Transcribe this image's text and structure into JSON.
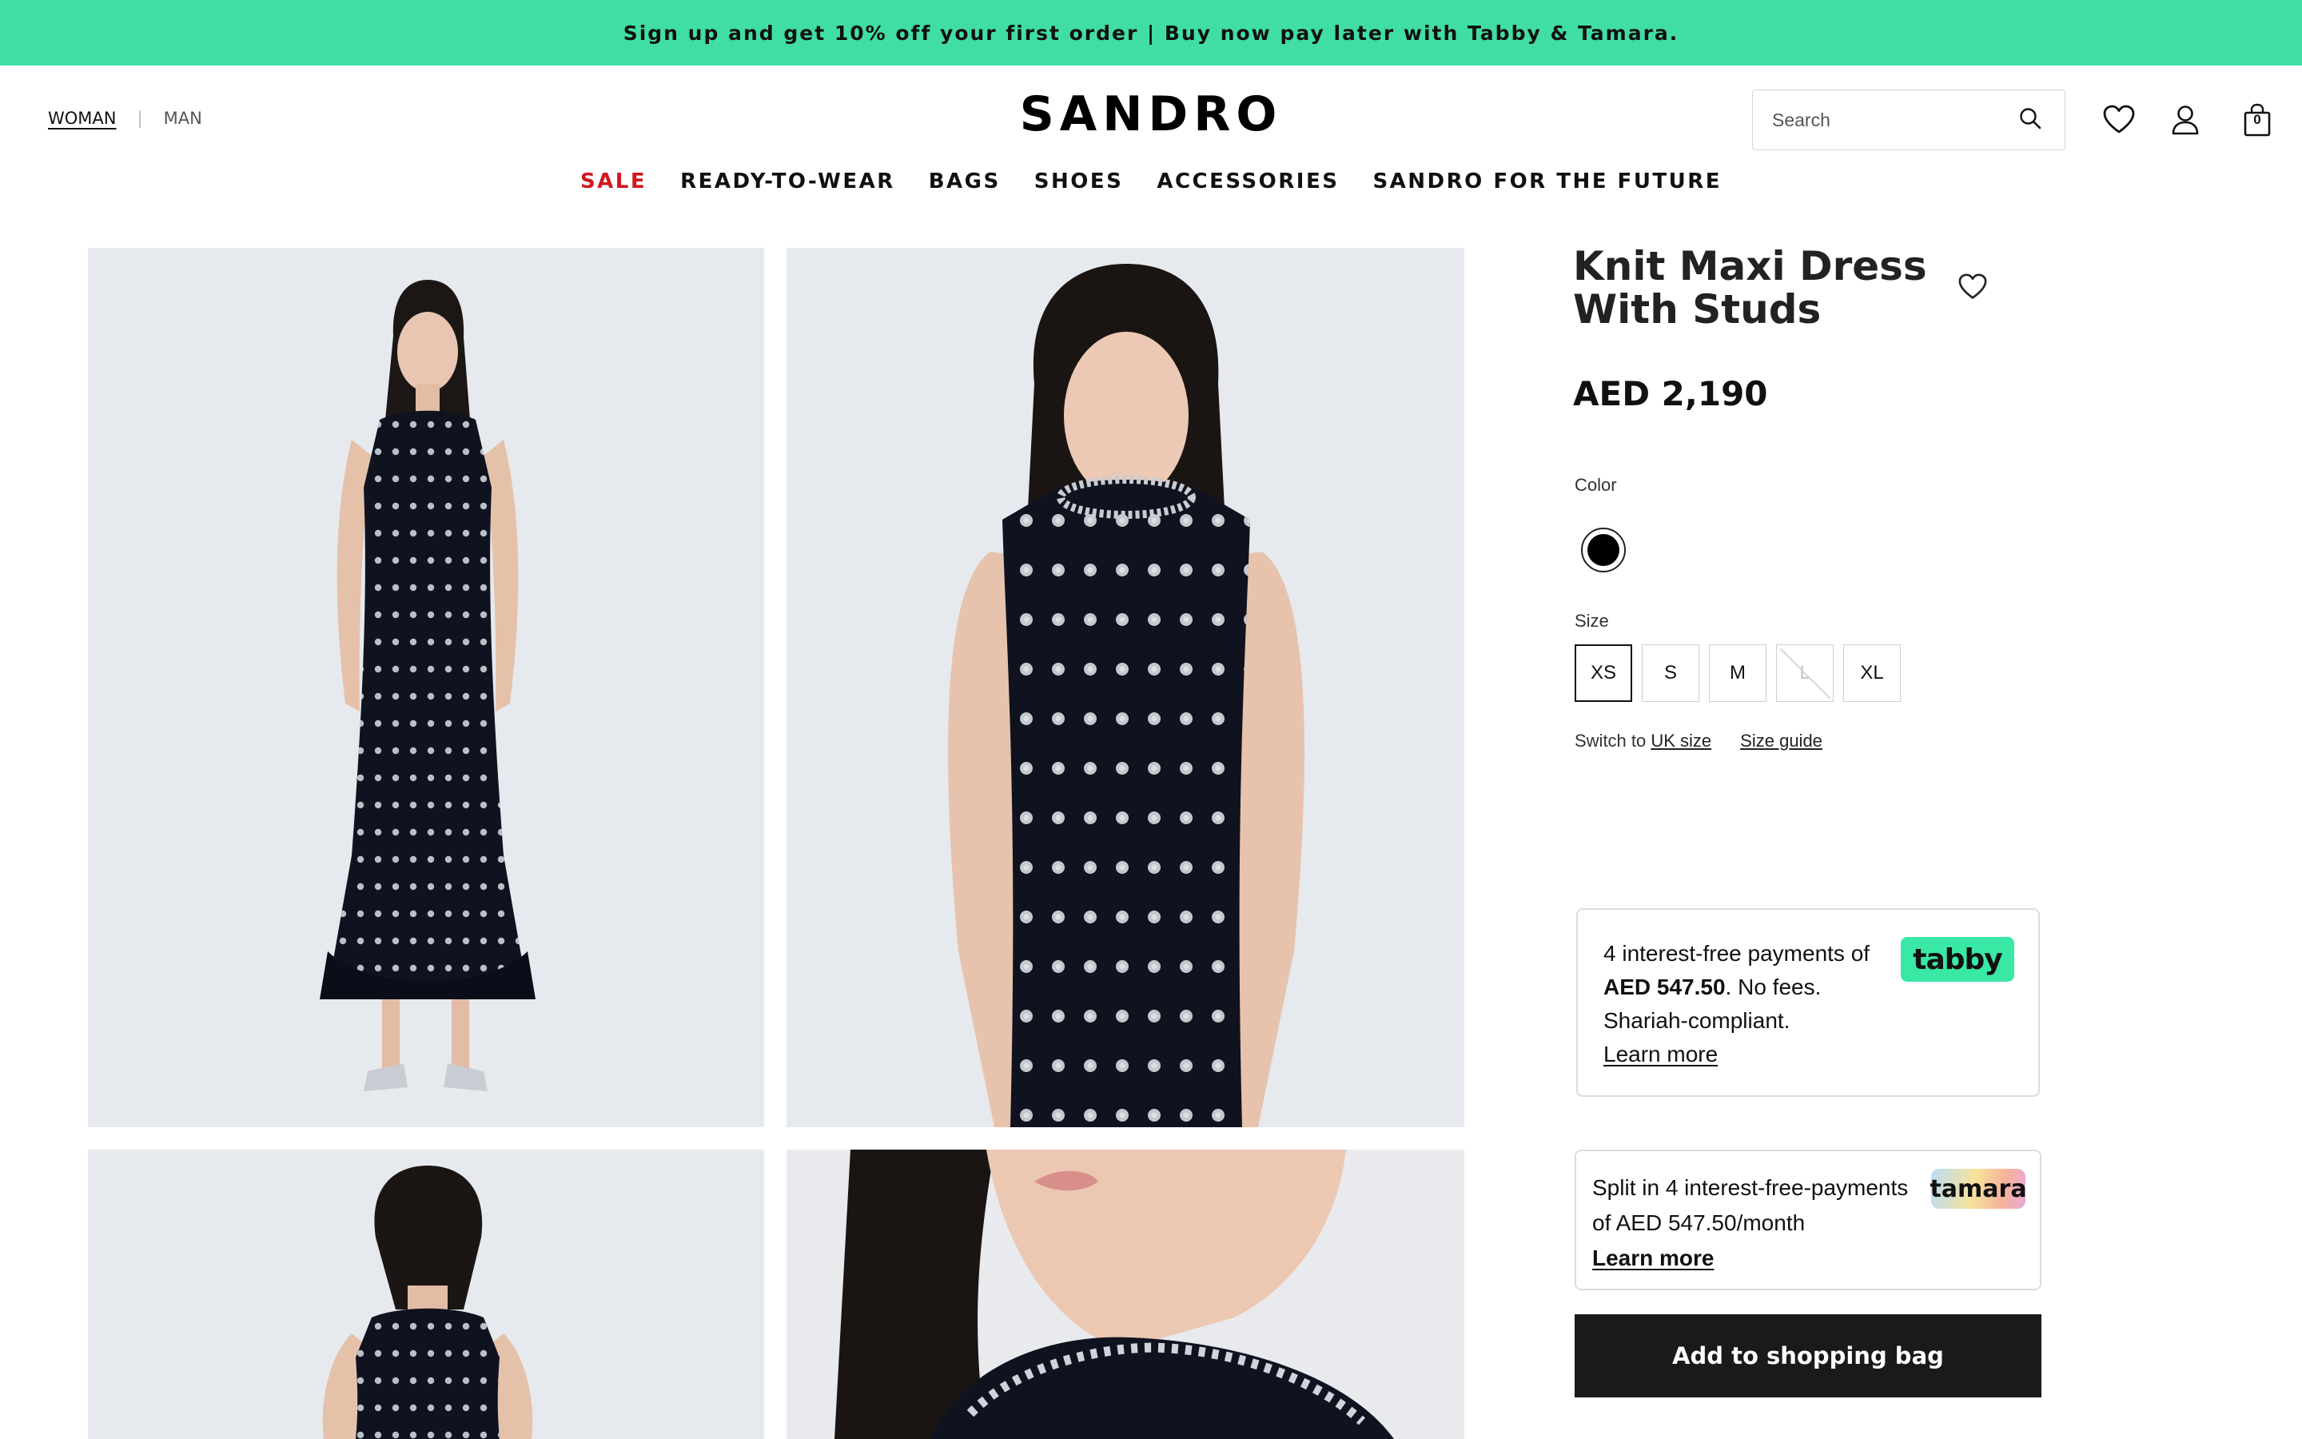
{
  "promo": {
    "text": "Sign up and get 10% off your first order | Buy now pay later with Tabby & Tamara."
  },
  "header": {
    "gender_active": "WOMAN",
    "gender_inactive": "MAN",
    "logo": "SANDRO",
    "search_placeholder": "Search",
    "bag_count": "0",
    "icons": [
      "search-icon",
      "heart-icon",
      "user-icon",
      "bag-icon"
    ]
  },
  "nav": {
    "items": [
      "SALE",
      "READY-TO-WEAR",
      "BAGS",
      "SHOES",
      "ACCESSORIES",
      "SANDRO FOR THE FUTURE"
    ]
  },
  "product": {
    "title": "Knit Maxi Dress With Studs",
    "price": "AED 2,190",
    "color_label": "Color",
    "color_selected": "#000000",
    "size_label": "Size",
    "sizes": [
      "XS",
      "S",
      "M",
      "L",
      "XL"
    ],
    "size_selected": "XS",
    "size_unavailable": "L",
    "switch_text": "Switch to ",
    "switch_link": "UK size",
    "size_guide": "Size guide"
  },
  "tabby": {
    "line1": "4 interest-free payments of",
    "amount": "AED 547.50",
    "line2": ". No fees. Shariah-compliant.",
    "learn_more": "Learn more",
    "logo": "tabby",
    "brand_color": "#3ae8a6"
  },
  "tamara": {
    "text": "Split in 4 interest-free-payments of AED 547.50/month",
    "learn_more": "Learn more",
    "logo": "tamara"
  },
  "cta": {
    "add_to_bag": "Add to shopping bag"
  },
  "colors": {
    "promo_bg": "#40dea4",
    "sale": "#d0181e",
    "cta_bg": "#1a1a1a"
  }
}
